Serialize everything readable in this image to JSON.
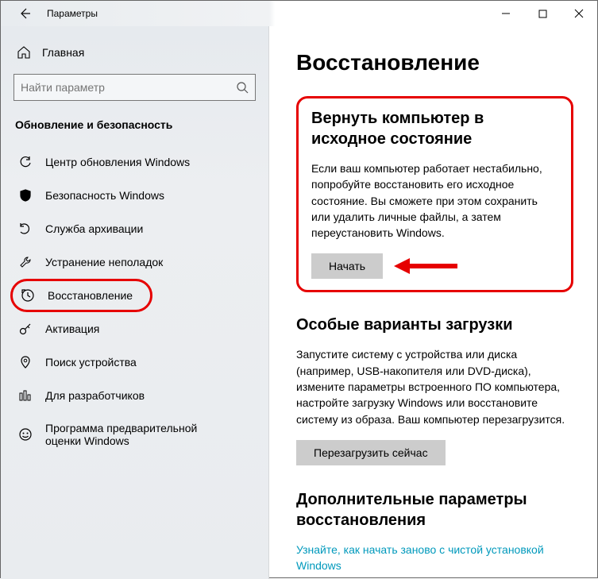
{
  "titlebar": {
    "title": "Параметры"
  },
  "sidebar": {
    "home": "Главная",
    "search_placeholder": "Найти параметр",
    "section_label": "Обновление и безопасность",
    "items": [
      {
        "label": "Центр обновления Windows"
      },
      {
        "label": "Безопасность Windows"
      },
      {
        "label": "Служба архивации"
      },
      {
        "label": "Устранение неполадок"
      },
      {
        "label": "Восстановление"
      },
      {
        "label": "Активация"
      },
      {
        "label": "Поиск устройства"
      },
      {
        "label": "Для разработчиков"
      },
      {
        "label": "Программа предварительной оценки Windows"
      }
    ]
  },
  "main": {
    "heading": "Восстановление",
    "reset": {
      "title": "Вернуть компьютер в исходное состояние",
      "desc": "Если ваш компьютер работает нестабильно, попробуйте восстановить его исходное состояние. Вы сможете при этом сохранить или удалить личные файлы, а затем переустановить Windows.",
      "button": "Начать"
    },
    "advanced": {
      "title": "Особые варианты загрузки",
      "desc": "Запустите систему с устройства или диска (например, USB-накопителя или DVD-диска), измените параметры встроенного ПО компьютера, настройте загрузку Windows или восстановите систему из образа. Ваш компьютер перезагрузится.",
      "button": "Перезагрузить сейчас"
    },
    "more": {
      "title": "Дополнительные параметры восстановления",
      "link": "Узнайте, как начать заново с чистой установкой Windows"
    }
  }
}
